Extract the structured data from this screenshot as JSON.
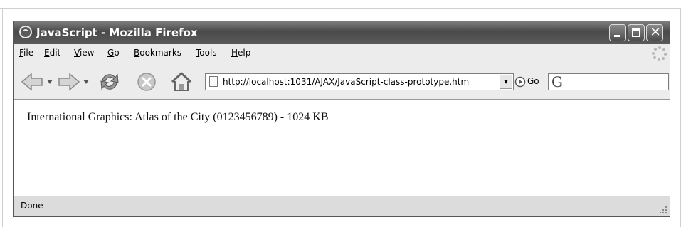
{
  "window": {
    "title": "JavaScript - Mozilla Firefox",
    "minimize_glyph": "",
    "maximize_glyph": "",
    "close_glyph": "✕"
  },
  "menu": [
    {
      "accel": "F",
      "rest": "ile"
    },
    {
      "accel": "E",
      "rest": "dit"
    },
    {
      "accel": "V",
      "rest": "iew"
    },
    {
      "accel": "G",
      "rest": "o"
    },
    {
      "accel": "B",
      "rest": "ookmarks"
    },
    {
      "accel": "T",
      "rest": "ools"
    },
    {
      "accel": "H",
      "rest": "elp"
    }
  ],
  "navbar": {
    "url": "http://localhost:1031/AJAX/JavaScript-class-prototype.htm",
    "url_dropdown_glyph": "▾",
    "go_label": "Go",
    "search_engine_glyph": "G"
  },
  "content": {
    "text": "International Graphics: Atlas of the City (0123456789) - 1024 KB"
  },
  "status": {
    "text": "Done"
  },
  "icons": {
    "back": "back-arrow-icon",
    "forward": "forward-arrow-icon",
    "reload": "reload-icon",
    "stop": "stop-icon",
    "home": "home-icon",
    "go": "go-icon",
    "page": "page-icon",
    "throbber": "throbber-icon"
  }
}
